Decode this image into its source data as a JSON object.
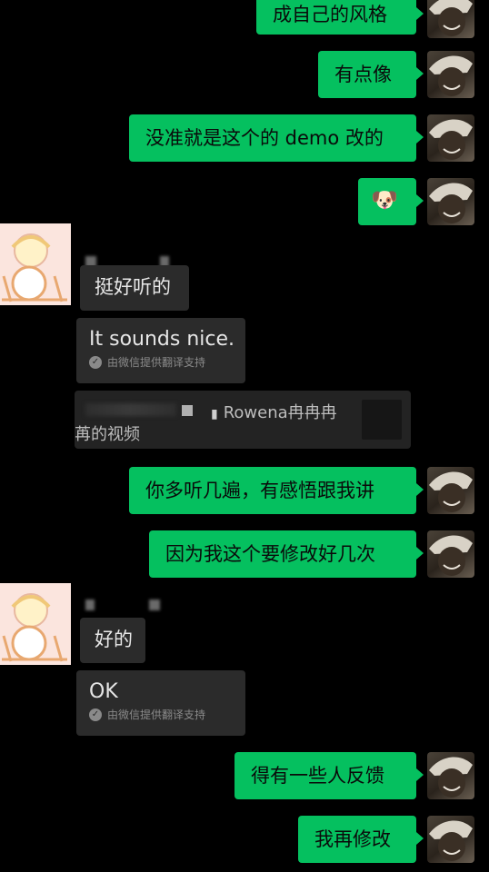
{
  "messages": [
    {
      "id": "m1",
      "side": "me",
      "text": "成自己的风格"
    },
    {
      "id": "m2",
      "side": "me",
      "text": "有点像"
    },
    {
      "id": "m3",
      "side": "me",
      "text": "没准就是这个的 demo 改的"
    },
    {
      "id": "m4",
      "side": "me",
      "emoji": "🐶"
    },
    {
      "id": "m5",
      "side": "them",
      "text": "挺好听的",
      "translation": "It sounds nice.",
      "translation_note": "由微信提供翻译支持"
    },
    {
      "id": "m6",
      "side": "them",
      "quote_author": "Rowena冉冉冉",
      "quote_text": "苒的视频"
    },
    {
      "id": "m7",
      "side": "me",
      "text": "你多听几遍，有感悟跟我讲"
    },
    {
      "id": "m8",
      "side": "me",
      "text": "因为我这个要修改好几次"
    },
    {
      "id": "m9",
      "side": "them",
      "text": "好的",
      "translation": "OK",
      "translation_note": "由微信提供翻译支持"
    },
    {
      "id": "m10",
      "side": "me",
      "text": "得有一些人反馈"
    },
    {
      "id": "m11",
      "side": "me",
      "text": "我再修改"
    }
  ],
  "colors": {
    "background": "#000000",
    "my_bubble": "#05c05f",
    "their_bubble": "#2b2b2b",
    "note_text": "#8a8a8a"
  },
  "icons": {
    "check": "check-circle-icon",
    "quote_file": "file-icon"
  }
}
